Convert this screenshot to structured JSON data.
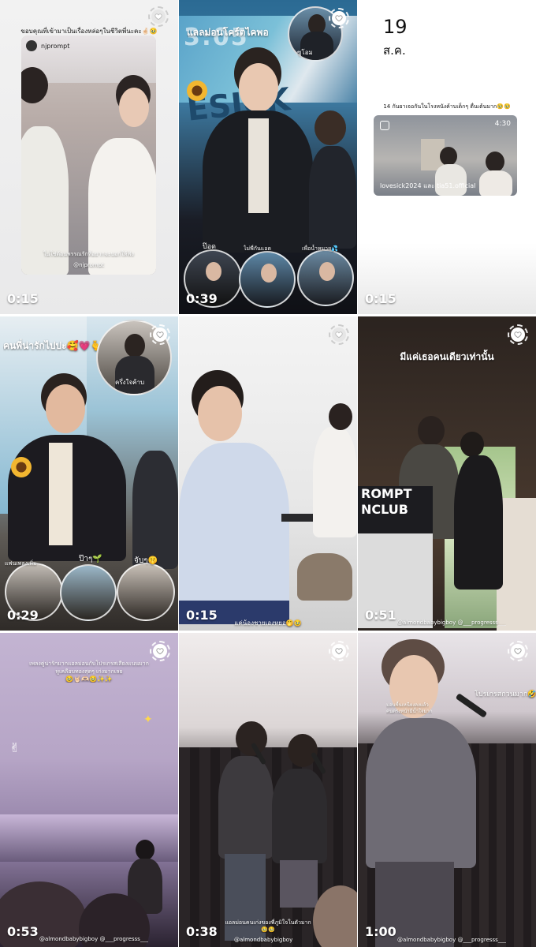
{
  "grid": {
    "tiles": [
      {
        "id": "story-1",
        "duration": "0:15",
        "caption_top": "ขอบคุณที่เข้ามาเป็นเรื่องหล่อๆในชีวิตพี่นะคะ🤞🏻🥹",
        "username": "njprompt",
        "caption_bottom": "ในใช่ต้อนพรรณรักที่อยากจะบอกให้ฟัง",
        "caption_bottom_user": "@njprompt"
      },
      {
        "id": "story-2",
        "duration": "0:39",
        "caption_top": "แลลม่อนโคร์ตไคพอ",
        "inset_label": "ซูโอม",
        "inset_label_2": "ป๊อด",
        "caption_mid_1": "ไม่พี่กันแอด",
        "caption_mid_2": "เพื่อน้ำหมาย💦"
      },
      {
        "id": "story-3",
        "duration": "0:15",
        "day": "19",
        "month": "ส.ค.",
        "note": "14 กันยาเจอกันในโรงหนังค้าบเด็กๆ ตื่นเต้นมาก🥹🥹",
        "card_time": "4:30",
        "card_credit": "lovesick2024 และ tia51.official"
      },
      {
        "id": "story-4",
        "duration": "0:29",
        "caption_top": "คนพี่น่ารักไปปะ🥰💗🫰",
        "inset_label": "ครึ่งใจค้าบ",
        "label_left": "ป๊าๆ🌱",
        "label_right": "จับๆ🤫",
        "caption_bottom_left": "แฟนเพลงเพิ่ม"
      },
      {
        "id": "story-5",
        "duration": "0:15",
        "caption_bottom": "แค่น้องชายเองหยอ🤭🥹"
      },
      {
        "id": "story-6",
        "duration": "0:51",
        "caption_top": "มีแค่เธอคนเดียวเท่านั้น",
        "sign_line_1": "ROMPT",
        "sign_line_2": "NCLUB",
        "credit": "@almondbabybigboy @___progresss___"
      },
      {
        "id": "story-7",
        "duration": "0:53",
        "caption_top_1": "เพลงคู่น่ารักมากแอลม่อนกับโปรเกรสเสียงแนนมาก",
        "caption_top_2": "หูเคลือบทองสุดๆ เก่งมากเลย",
        "caption_top_3": "🥹🤘🏻🫶🏻🥹✨✨",
        "credit": "@almondbabybigboy @___progresss___"
      },
      {
        "id": "story-8",
        "duration": "0:38",
        "caption_bottom_1": "แอลม่อนคนเก่งของพี่ภูมิใจในตัวมาก",
        "caption_bottom_2": "🥹🥹",
        "credit": "@almondbabybigboy"
      },
      {
        "id": "story-9",
        "duration": "1:00",
        "caption_left": "ม่อนพื้นเหนียงลงแล้ว",
        "caption_left_2": "คนตรงหน้ามีน้ำใจมาก",
        "caption_right": "โปรเกรสกวนมาก🤣🤣",
        "credit": "@almondbabybigboy @___progresss___"
      }
    ]
  },
  "colors": {
    "badge": "#ffffff",
    "text_light": "#ffffff",
    "text_dark": "#111111"
  },
  "icons": {
    "heart": "heart-icon",
    "reel": "reels-icon"
  }
}
